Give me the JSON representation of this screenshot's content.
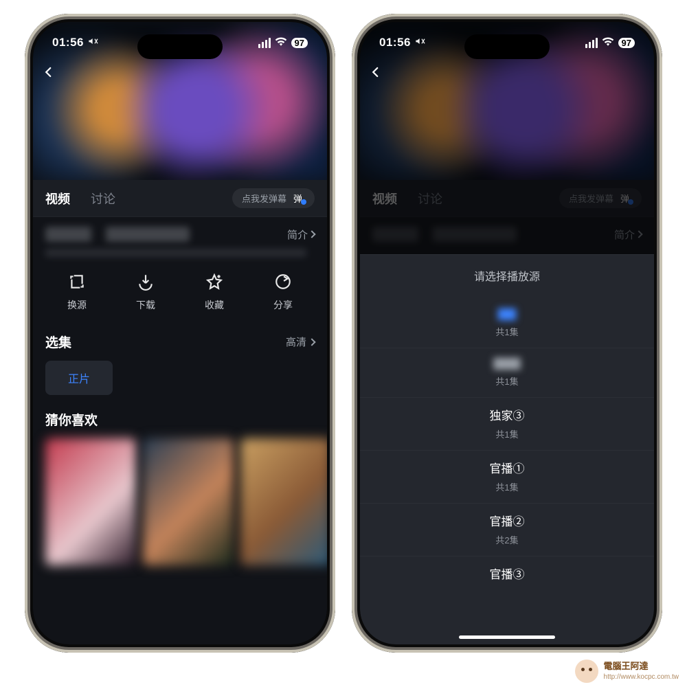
{
  "status": {
    "time": "01:56",
    "battery": "97"
  },
  "tabs": {
    "video": "视频",
    "discuss": "讨论"
  },
  "danmu": {
    "placeholder": "点我发弹幕",
    "toggle": "弹"
  },
  "brief_label": "简介",
  "actions": {
    "source": "换源",
    "download": "下载",
    "favorite": "收藏",
    "share": "分享"
  },
  "episodes": {
    "title": "选集",
    "quality": "高清",
    "chip": "正片"
  },
  "recs_title": "猜你喜欢",
  "sheet": {
    "title": "请选择播放源",
    "sources": [
      {
        "name": "▇▇",
        "count": "共1集",
        "blurred": true,
        "variant": "blue"
      },
      {
        "name": "▇▇▇",
        "count": "共1集",
        "blurred": true,
        "variant": "grey"
      },
      {
        "name": "独家③",
        "count": "共1集"
      },
      {
        "name": "官播①",
        "count": "共1集"
      },
      {
        "name": "官播②",
        "count": "共2集"
      },
      {
        "name": "官播③",
        "count": ""
      }
    ]
  },
  "watermark": {
    "brand": "電腦王阿達",
    "url": "http://www.kocpc.com.tw"
  }
}
